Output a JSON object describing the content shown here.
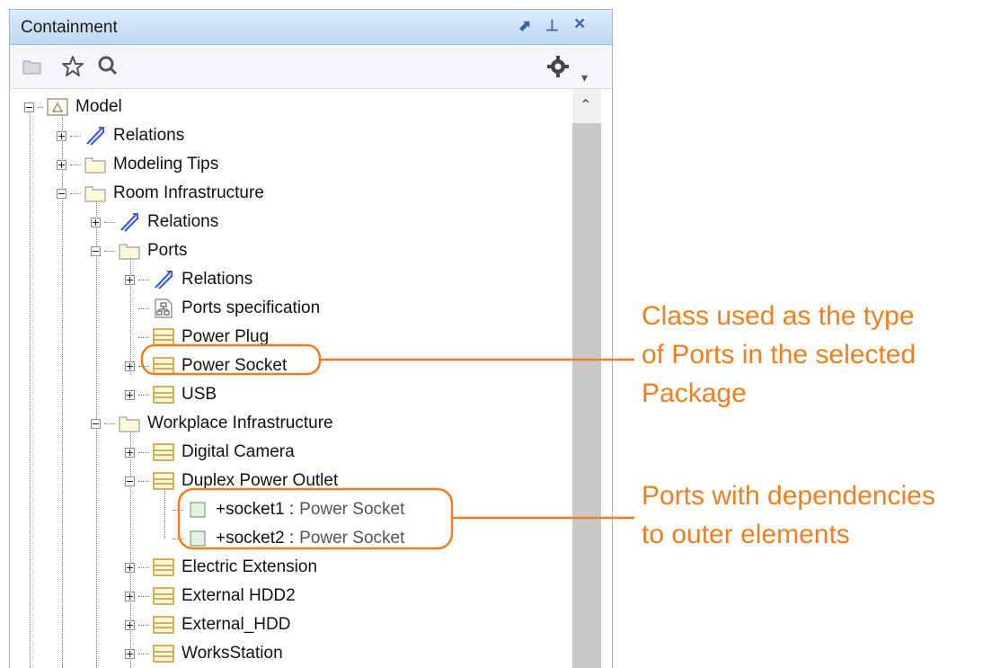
{
  "panel": {
    "title": "Containment",
    "buttons": {
      "float": "⬈",
      "pin": "⊥",
      "close": "×"
    }
  },
  "toolbar": {
    "icons": [
      "open-folder-icon",
      "star-icon",
      "search-icon",
      "gear-icon",
      "dropdown-arrow-icon"
    ]
  },
  "tree": {
    "items": [
      {
        "label": "Model",
        "icon": "model-icon"
      },
      {
        "label": "Relations",
        "icon": "relations-icon"
      },
      {
        "label": "Modeling Tips",
        "icon": "package-icon"
      },
      {
        "label": "Room Infrastructure",
        "icon": "package-icon"
      },
      {
        "label": "Relations",
        "icon": "relations-icon"
      },
      {
        "label": "Ports",
        "icon": "package-icon"
      },
      {
        "label": "Relations",
        "icon": "relations-icon"
      },
      {
        "label": "Ports specification",
        "icon": "diagram-icon"
      },
      {
        "label": "Power Plug",
        "icon": "class-icon"
      },
      {
        "label": "Power Socket",
        "icon": "class-icon"
      },
      {
        "label": "USB",
        "icon": "class-icon"
      },
      {
        "label": "Workplace Infrastructure",
        "icon": "package-icon"
      },
      {
        "label": "Digital Camera",
        "icon": "class-icon"
      },
      {
        "label": "Duplex Power Outlet",
        "icon": "class-icon"
      },
      {
        "label": "+socket1 :",
        "type": "Power Socket",
        "icon": "port-icon"
      },
      {
        "label": "+socket2 :",
        "type": "Power Socket",
        "icon": "port-icon"
      },
      {
        "label": "Electric Extension",
        "icon": "class-icon"
      },
      {
        "label": "External HDD2",
        "icon": "class-icon"
      },
      {
        "label": "External_HDD",
        "icon": "class-icon"
      },
      {
        "label": "WorksStation",
        "icon": "class-icon"
      }
    ]
  },
  "annotations": {
    "class_note": [
      "Class used as the type",
      "of Ports in the selected",
      "Package"
    ],
    "ports_note": [
      "Ports with dependencies",
      "to outer elements"
    ],
    "accent_color": "#f07d1e"
  }
}
